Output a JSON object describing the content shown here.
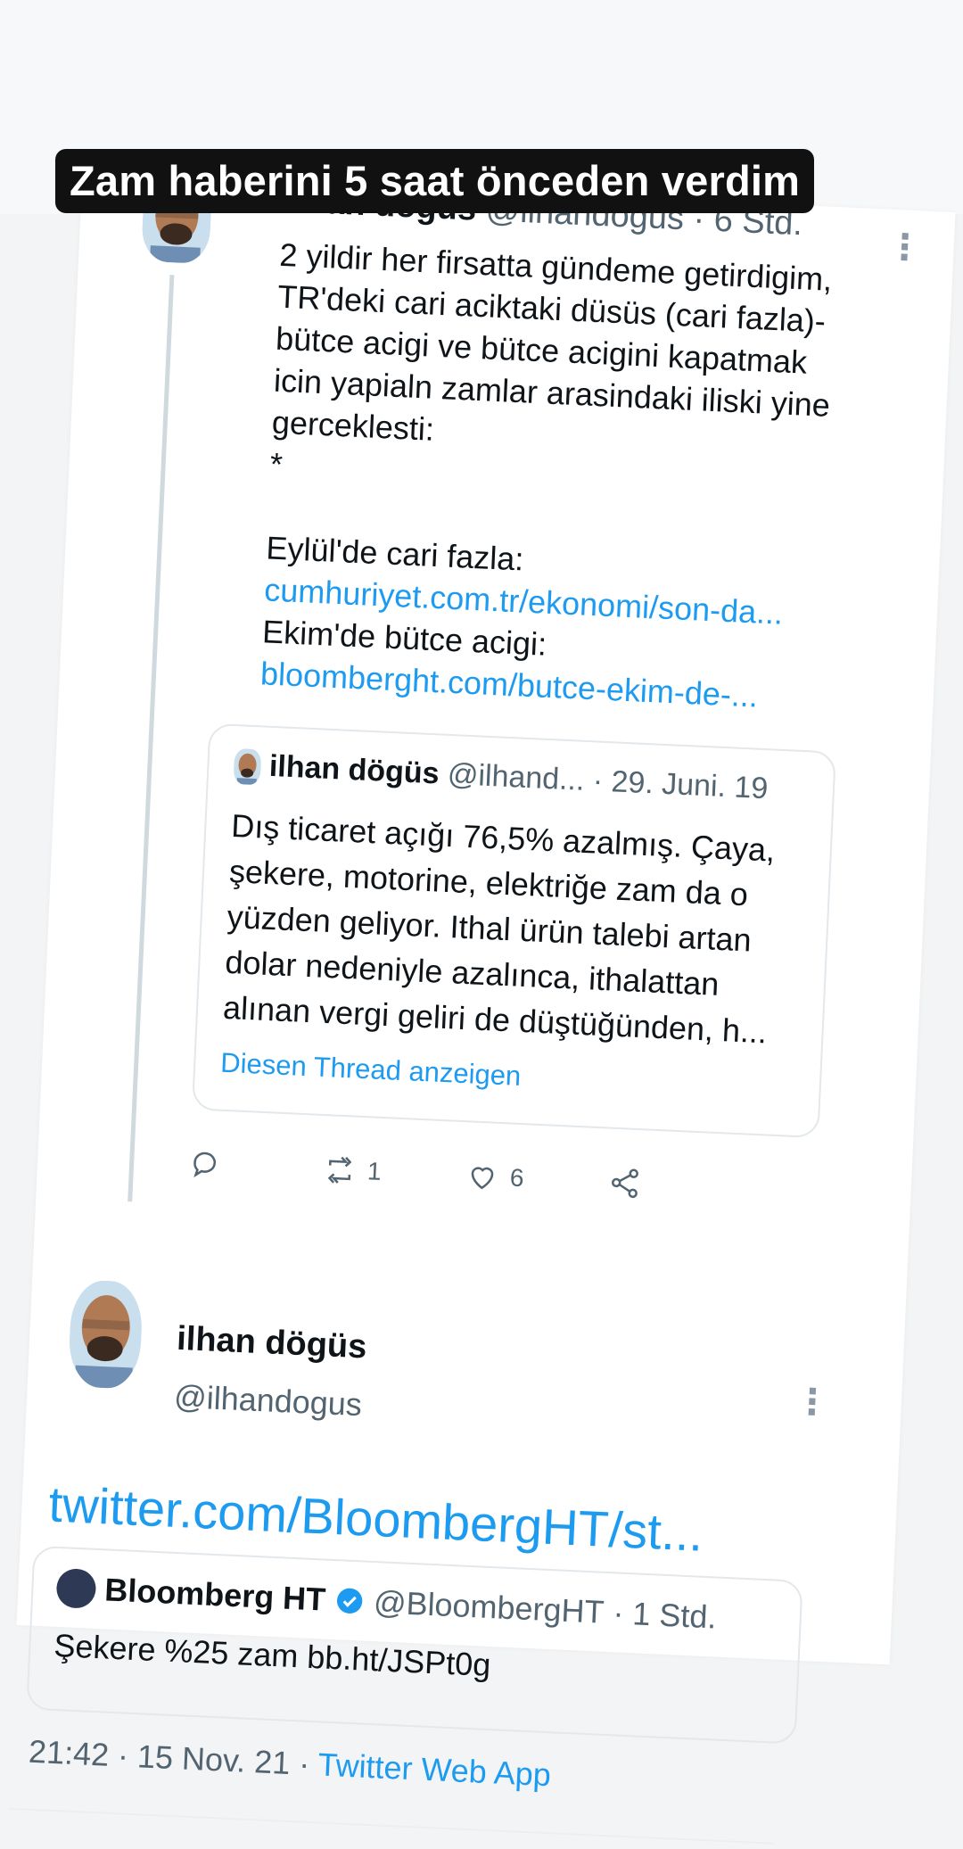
{
  "overlay": {
    "caption": "Zam haberini 5 saat önceden verdim"
  },
  "tweet1": {
    "author_name": "ilhan dögüs",
    "author_handle": "@ilhandogus",
    "time": "· 6 Std.",
    "lines": [
      "2 yildir her firsatta gündeme getirdigim,",
      "TR'deki cari aciktaki düsüs (cari fazla)-",
      "bütce acigi ve bütce acigini kapatmak",
      "icin yapialn zamlar arasindaki iliski yine",
      "gerceklesti:",
      "*",
      "",
      "Eylül'de cari fazla:"
    ],
    "link1": "cumhuriyet.com.tr/ekonomi/son-da...",
    "line_after_link1": "Ekim'de bütce acigi:",
    "link2": "bloomberght.com/butce-ekim-de-...",
    "quoted": {
      "author_name": "ilhan dögüs",
      "author_handle": "@ilhand...",
      "date": "· 29. Juni. 19",
      "text": "Dış ticaret açığı 76,5% azalmış. Çaya, şekere, motorine, elektriğe zam da o yüzden geliyor. Ithal ürün talebi artan dolar nedeniyle azalınca, ithalattan alınan vergi geliri de düştüğünden, h...",
      "show_thread": "Diesen Thread anzeigen"
    },
    "actions": {
      "reply_icon": "reply-icon",
      "retweet_icon": "retweet-icon",
      "retweet_count": "1",
      "like_icon": "heart-icon",
      "like_count": "6",
      "share_icon": "share-icon"
    }
  },
  "tweet2": {
    "author_name": "ilhan dögüs",
    "author_handle": "@ilhandogus",
    "link": "twitter.com/BloombergHT/st...",
    "quoted": {
      "author_name": "Bloomberg HT",
      "author_handle": "@BloombergHT",
      "time": "· 1 Std.",
      "text": "Şekere %25 zam bb.ht/JSPt0g"
    },
    "meta_time": "21:42 · 15 Nov. 21 ·",
    "meta_source": "Twitter Web App"
  },
  "colors": {
    "link": "#1d9bf0",
    "muted": "#536471",
    "caption_bg": "#111111"
  }
}
